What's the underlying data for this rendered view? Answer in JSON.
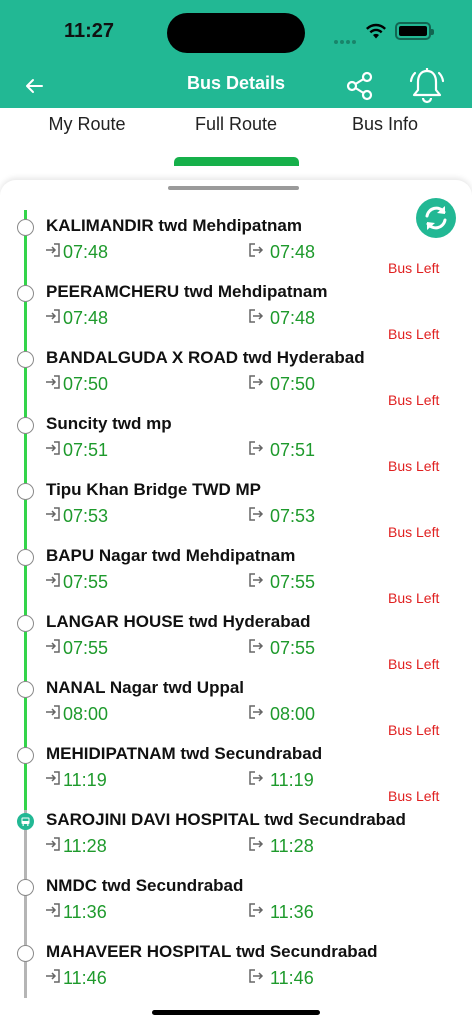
{
  "status_bar": {
    "time": "11:27"
  },
  "header": {
    "title": "Bus Details"
  },
  "tabs": [
    {
      "label": "My Route"
    },
    {
      "label": "Full Route"
    },
    {
      "label": "Bus Info"
    }
  ],
  "colors": {
    "brand": "#22b894",
    "time_green": "#1e9a2c",
    "bus_left_red": "#e02020",
    "active_tab": "#16b04a"
  },
  "stops": [
    {
      "name": "KALIMANDIR twd Mehdipatnam",
      "arrival": "07:48",
      "departure": "07:48",
      "status": "Bus Left"
    },
    {
      "name": "PEERAMCHERU twd Mehdipatnam",
      "arrival": "07:48",
      "departure": "07:48",
      "status": "Bus Left"
    },
    {
      "name": "BANDALGUDA X ROAD twd Hyderabad",
      "arrival": "07:50",
      "departure": "07:50",
      "status": "Bus Left"
    },
    {
      "name": "Suncity twd mp",
      "arrival": "07:51",
      "departure": "07:51",
      "status": "Bus Left"
    },
    {
      "name": "Tipu Khan Bridge TWD MP",
      "arrival": "07:53",
      "departure": "07:53",
      "status": "Bus Left"
    },
    {
      "name": "BAPU Nagar twd Mehdipatnam",
      "arrival": "07:55",
      "departure": "07:55",
      "status": "Bus Left"
    },
    {
      "name": "LANGAR HOUSE twd Hyderabad",
      "arrival": "07:55",
      "departure": "07:55",
      "status": "Bus Left"
    },
    {
      "name": "NANAL Nagar twd Uppal",
      "arrival": "08:00",
      "departure": "08:00",
      "status": "Bus Left"
    },
    {
      "name": "MEHIDIPATNAM twd Secundrabad",
      "arrival": "11:19",
      "departure": "11:19",
      "status": "Bus Left"
    },
    {
      "name": "SAROJINI DAVI HOSPITAL twd Secundrabad",
      "arrival": "11:28",
      "departure": "11:28",
      "status": ""
    },
    {
      "name": "NMDC twd Secundrabad",
      "arrival": "11:36",
      "departure": "11:36",
      "status": ""
    },
    {
      "name": "MAHAVEER HOSPITAL twd Secundrabad",
      "arrival": "11:46",
      "departure": "11:46",
      "status": ""
    }
  ]
}
